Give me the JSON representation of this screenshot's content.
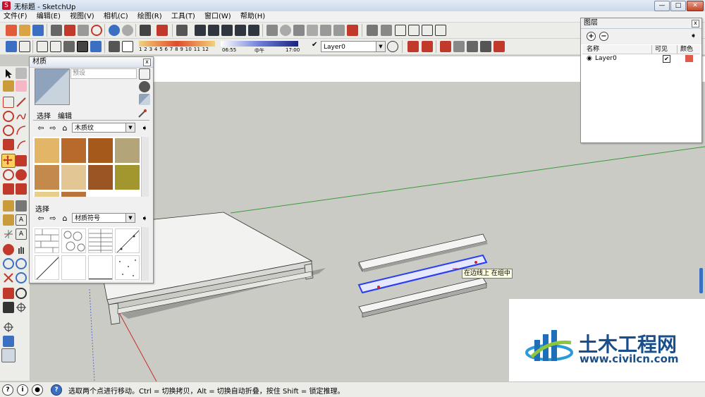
{
  "window": {
    "title": "无标题 - SketchUp",
    "min": "—",
    "max": "□",
    "close": "✕"
  },
  "menu": [
    "文件(F)",
    "编辑(E)",
    "视图(V)",
    "相机(C)",
    "绘图(R)",
    "工具(T)",
    "窗口(W)",
    "帮助(H)"
  ],
  "shadow_bar": {
    "months": [
      "1",
      "2",
      "3",
      "4",
      "5",
      "6",
      "7",
      "8",
      "9",
      "10",
      "11",
      "12"
    ],
    "time_start": "06:55",
    "time_mid": "中午",
    "time_end": "17:00"
  },
  "layer_select": {
    "value": "Layer0"
  },
  "materials": {
    "title": "材质",
    "name_placeholder": "预设",
    "tab_select": "选择",
    "tab_edit": "编辑",
    "library_top": "木质纹",
    "section2_label": "选择",
    "library_bottom": "材质符号",
    "close": "x"
  },
  "layers": {
    "title": "图层",
    "col_name": "名称",
    "col_visible": "可见",
    "col_color": "颜色",
    "rows": [
      {
        "name": "Layer0",
        "visible": true,
        "color": "#e05a4a"
      }
    ],
    "close": "x"
  },
  "tooltip": "在边线上 在组中",
  "status": {
    "message": "选取两个点进行移动。Ctrl = 切换拷贝，Alt = 切换自动折叠，按住 Shift = 锁定推理。",
    "help": "?"
  },
  "watermark": {
    "brand": "土木工程网",
    "url": "www.civilcn.com"
  },
  "colors": {
    "accent_blue": "#2a3ff0",
    "axis_green": "#3a9a3a",
    "axis_red": "#cc2a2a",
    "layer_red": "#e05a4a"
  }
}
